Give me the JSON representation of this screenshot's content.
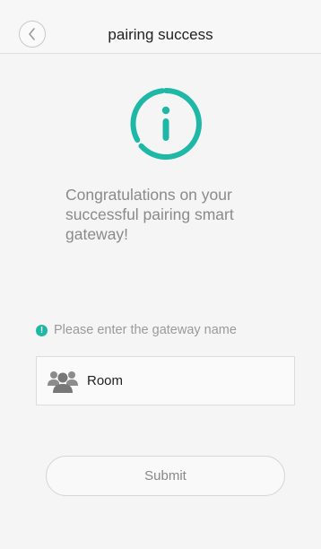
{
  "header": {
    "title": "pairing success",
    "back_icon": "chevron-left-icon"
  },
  "status": {
    "icon": "info-circle-icon",
    "accent_color": "#1fb8a7",
    "message": "Congratulations on your successful pairing smart gateway!"
  },
  "form": {
    "prompt_icon": "exclamation-circle-icon",
    "prompt_text": "Please enter the gateway name",
    "name_field": {
      "icon": "group-icon",
      "value": "Room"
    },
    "submit_label": "Submit"
  }
}
